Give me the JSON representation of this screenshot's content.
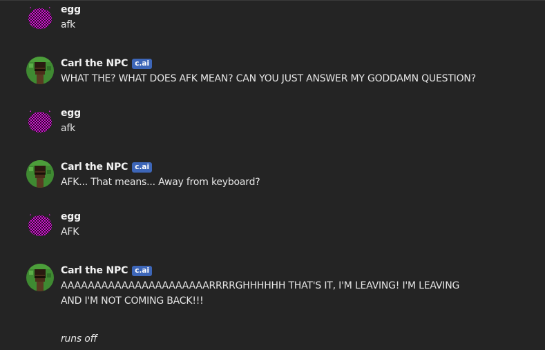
{
  "messages": [
    {
      "author": "egg",
      "text": "afk"
    },
    {
      "author": "Carl the NPC",
      "badge": "c.ai",
      "text": "WHAT THE? WHAT DOES AFK MEAN? CAN YOU JUST ANSWER MY GODDAMN QUESTION?"
    },
    {
      "author": "egg",
      "text": "afk"
    },
    {
      "author": "Carl the NPC",
      "badge": "c.ai",
      "text": "AFK... That means... Away from keyboard?"
    },
    {
      "author": "egg",
      "text": "AFK"
    },
    {
      "author": "Carl the NPC",
      "badge": "c.ai",
      "text": "AAAAAAAAAAAAAAAAAAAAAARRRRGHHHHHH THAT'S IT, I'M LEAVING! I'M LEAVING\nAND I'M NOT COMING BACK!!!",
      "action": "runs off"
    }
  ],
  "colors": {
    "background": "#242424",
    "badge": "#3d66b8",
    "egg_avatar": "#d01ad0",
    "carl_avatar_bg": "#3f8a32",
    "carl_avatar_face": "#4a2e1a"
  },
  "icons": {
    "egg_avatar": "pink-checkered-egg-avatar-icon",
    "carl_avatar": "minecraft-npc-avatar-icon"
  }
}
